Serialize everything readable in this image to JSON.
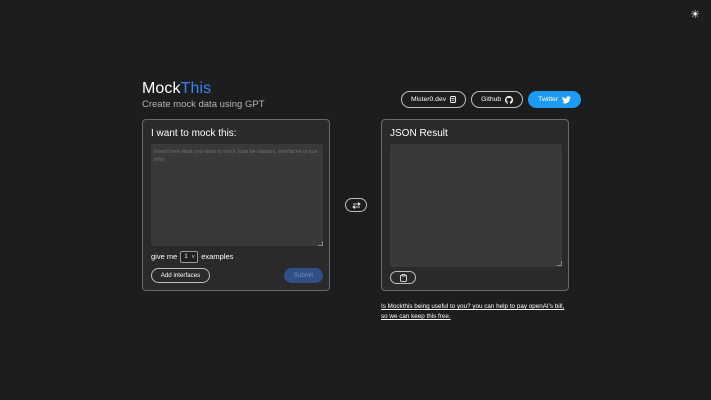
{
  "header": {
    "title_part1": "Mock",
    "title_part2": "This",
    "tagline": "Create mock data using GPT",
    "accent_color": "#3b82f6",
    "theme_toggle_icon": "sun-icon"
  },
  "links": {
    "author_label": "Mister0.dev",
    "author_icon": "badge-icon",
    "github_label": "Github",
    "github_icon": "github-icon",
    "twitter_label": "Twitter",
    "twitter_icon": "twitter-icon",
    "twitter_color": "#1d9bf0"
  },
  "input_panel": {
    "title": "I want to mock this:",
    "placeholder": "Insert here what you want to mock (can be classes, interfaces or just info)",
    "value": "",
    "count_prefix": "give me",
    "count_value": "1",
    "count_suffix": "examples",
    "add_interfaces_label": "Add interfaces",
    "submit_label": "Submit"
  },
  "swap_icon": "swap-arrows-icon",
  "result_panel": {
    "title": "JSON Result",
    "copy_icon": "clipboard-icon"
  },
  "support": {
    "text": "Is Mockthis being useful to you? you can help to pay openAI's bill, so we can keep this free."
  }
}
